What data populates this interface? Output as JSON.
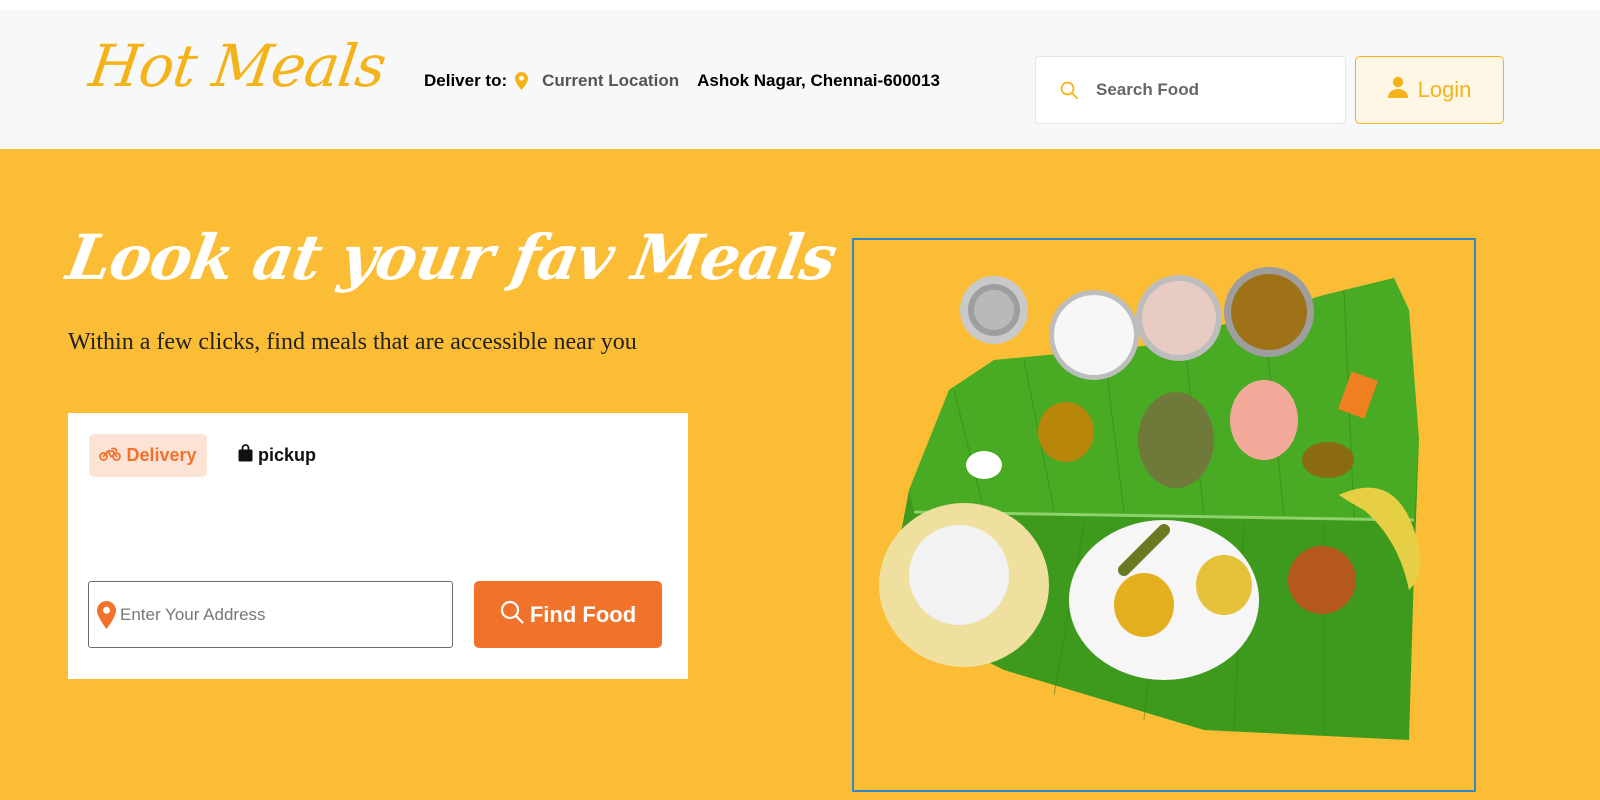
{
  "header": {
    "logo": "Hot Meals",
    "deliver_label": "Deliver to:",
    "current_location": "Current Location",
    "address": "Ashok Nagar, Chennai-600013",
    "search_placeholder": "Search Food",
    "login_label": "Login"
  },
  "hero": {
    "title": "Look at your fav Meals",
    "subtitle": "Within a few clicks, find meals that are accessible near you"
  },
  "finder": {
    "tabs": [
      {
        "label": "Delivery",
        "icon": "motorcycle-icon",
        "active": true
      },
      {
        "label": "pickup",
        "icon": "shopping-bag-icon",
        "active": false
      }
    ],
    "address_placeholder": "Enter Your Address",
    "find_button": "Find Food"
  },
  "colors": {
    "brand_yellow": "#fbbd35",
    "logo_yellow": "#f5b31a",
    "accent_orange": "#f1722a",
    "frame_blue": "#2f8bc8"
  }
}
